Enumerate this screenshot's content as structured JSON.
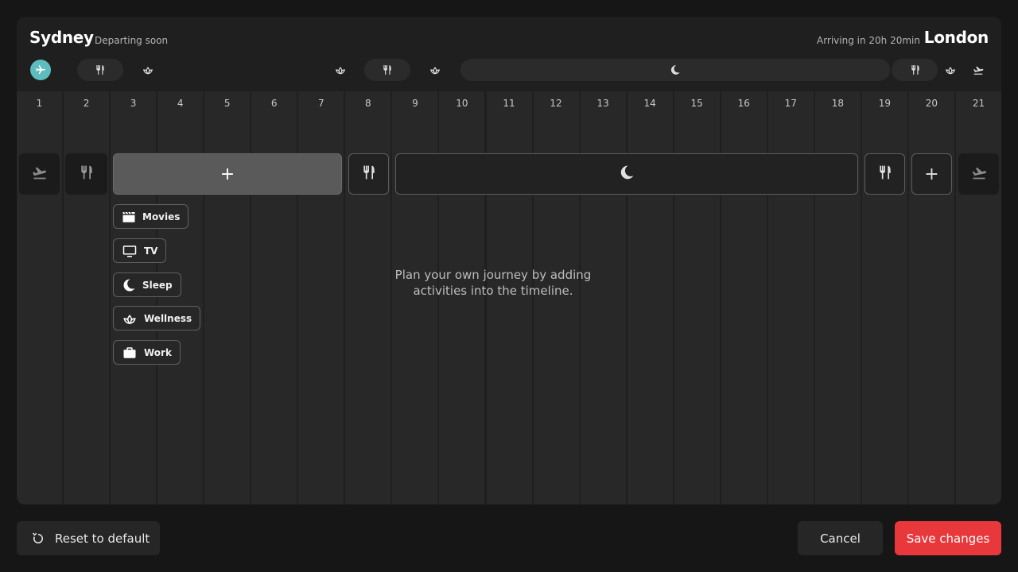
{
  "header": {
    "origin": "Sydney",
    "origin_status": "Departing soon",
    "destination": "London",
    "arrival_status": "Arriving in 20h 20min"
  },
  "strip_icons": [
    "airplane-icon",
    "fork-knife-icon",
    "lotus-icon",
    "lotus-icon",
    "fork-knife-icon",
    "lotus-icon",
    "moon-icon",
    "fork-knife-icon",
    "lotus-icon",
    "landing-icon"
  ],
  "timeline": {
    "hours": [
      "1",
      "2",
      "3",
      "4",
      "5",
      "6",
      "7",
      "8",
      "9",
      "10",
      "11",
      "12",
      "13",
      "14",
      "15",
      "16",
      "17",
      "18",
      "19",
      "20",
      "21"
    ]
  },
  "blocks": [
    {
      "name": "takeoff-block",
      "icon": "takeoff-icon"
    },
    {
      "name": "meal-block-1",
      "icon": "fork-knife-icon"
    },
    {
      "name": "add-activity-block",
      "icon": "plus-icon",
      "label": "+"
    },
    {
      "name": "meal-block-2",
      "icon": "fork-knife-icon"
    },
    {
      "name": "sleep-block",
      "icon": "moon-icon"
    },
    {
      "name": "meal-block-3",
      "icon": "fork-knife-icon"
    },
    {
      "name": "add-activity-block-2",
      "icon": "plus-icon",
      "label": "+"
    },
    {
      "name": "landing-block",
      "icon": "landing-icon"
    }
  ],
  "activities": [
    {
      "label": "Movies",
      "icon": "clapperboard-icon"
    },
    {
      "label": "TV",
      "icon": "tv-icon"
    },
    {
      "label": "Sleep",
      "icon": "moon-icon"
    },
    {
      "label": "Wellness",
      "icon": "lotus-icon"
    },
    {
      "label": "Work",
      "icon": "briefcase-icon"
    }
  ],
  "empty_message": "Plan your own journey by adding activities into the timeline.",
  "footer": {
    "reset_label": "Reset to default",
    "cancel_label": "Cancel",
    "save_label": "Save changes"
  },
  "colors": {
    "accent_teal": "#5dbcbd",
    "save_red": "#e9383c",
    "panel_bg": "#1f1f1f",
    "page_bg": "#161616"
  }
}
